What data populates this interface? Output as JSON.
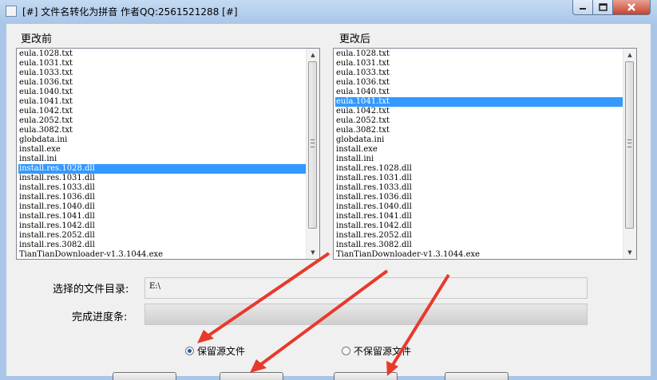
{
  "window": {
    "title": "[#] 文件名转化为拼音 作者QQ:2561521288 [#]",
    "controls": {
      "minimize": "minimize",
      "maximize": "maximize",
      "close": "close"
    }
  },
  "before_panel": {
    "label": "更改前",
    "items": [
      "eula.1028.txt",
      "eula.1031.txt",
      "eula.1033.txt",
      "eula.1036.txt",
      "eula.1040.txt",
      "eula.1041.txt",
      "eula.1042.txt",
      "eula.2052.txt",
      "eula.3082.txt",
      "globdata.ini",
      "install.exe",
      "install.ini",
      "install.res.1028.dll",
      "install.res.1031.dll",
      "install.res.1033.dll",
      "install.res.1036.dll",
      "install.res.1040.dll",
      "install.res.1041.dll",
      "install.res.1042.dll",
      "install.res.2052.dll",
      "install.res.3082.dll",
      "TianTianDownloader-v1.3.1044.exe"
    ],
    "selected_index": 12
  },
  "after_panel": {
    "label": "更改后",
    "items": [
      "eula.1028.txt",
      "eula.1031.txt",
      "eula.1033.txt",
      "eula.1036.txt",
      "eula.1040.txt",
      "eula.1041.txt",
      "eula.1042.txt",
      "eula.2052.txt",
      "eula.3082.txt",
      "globdata.ini",
      "install.exe",
      "install.ini",
      "install.res.1028.dll",
      "install.res.1031.dll",
      "install.res.1033.dll",
      "install.res.1036.dll",
      "install.res.1040.dll",
      "install.res.1041.dll",
      "install.res.1042.dll",
      "install.res.2052.dll",
      "install.res.3082.dll",
      "TianTianDownloader-v1.3.1044.exe"
    ],
    "selected_index": 5
  },
  "directory": {
    "label": "选择的文件目录:",
    "value": "E:\\"
  },
  "progress": {
    "label": "完成进度条:",
    "value": 0
  },
  "options": {
    "keep_source": {
      "label": "保留源文件",
      "checked": true
    },
    "no_keep_source": {
      "label": "不保留源文件",
      "checked": false
    }
  },
  "colors": {
    "selection": "#3399ff",
    "annotation_arrow": "#e8392b",
    "title_bar": "#a9c6e8"
  },
  "icons": {
    "app": "app-icon",
    "minimize": "minimize-icon",
    "maximize": "maximize-icon",
    "close": "close-icon"
  }
}
